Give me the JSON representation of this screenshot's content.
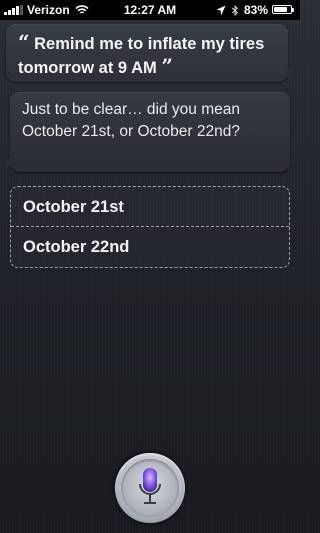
{
  "status_bar": {
    "carrier": "Verizon",
    "time": "12:27 AM",
    "battery": "83%",
    "battery_level": 0.83,
    "signal_bars": 4
  },
  "conversation": {
    "user_quote_open": "“",
    "user_query": "Remind me to inflate my tires tomorrow at 9 AM",
    "user_quote_close": "”",
    "siri_response": "Just to be clear… did you mean October 21st, or October 22nd?",
    "options": [
      {
        "label": "October 21st"
      },
      {
        "label": "October 22nd"
      }
    ]
  },
  "icons": {
    "wifi": "wifi-icon",
    "location": "location-arrow-icon",
    "bluetooth": "bluetooth-icon",
    "battery": "battery-icon",
    "microphone": "microphone-icon"
  },
  "colors": {
    "mic_accent": "#9b6cff",
    "background": "#1f2228"
  }
}
